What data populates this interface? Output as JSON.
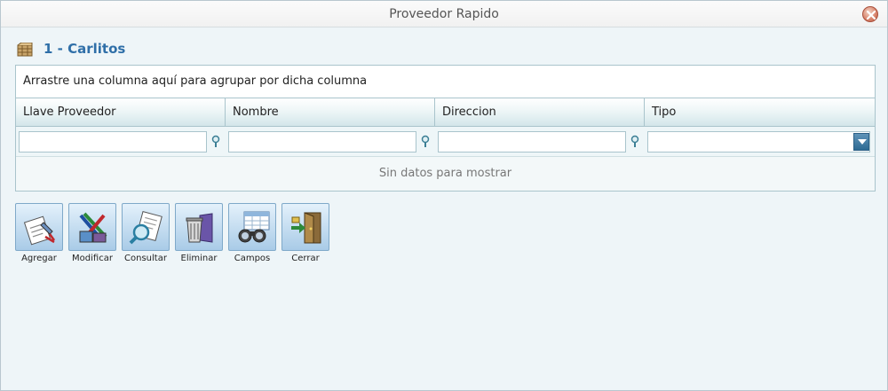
{
  "window": {
    "title": "Proveedor Rapido"
  },
  "heading": {
    "text": "1 - Carlitos"
  },
  "grid": {
    "group_panel_text": "Arrastre una columna aquí para agrupar por dicha columna",
    "columns": [
      "Llave Proveedor",
      "Nombre",
      "Direccion",
      "Tipo"
    ],
    "filters": [
      "",
      "",
      "",
      ""
    ],
    "empty_text": "Sin datos para mostrar"
  },
  "toolbar": {
    "buttons": [
      {
        "label": "Agregar",
        "icon": "add-document-icon"
      },
      {
        "label": "Modificar",
        "icon": "edit-pencils-icon"
      },
      {
        "label": "Consultar",
        "icon": "magnifier-document-icon"
      },
      {
        "label": "Eliminar",
        "icon": "trash-icon"
      },
      {
        "label": "Campos",
        "icon": "binoculars-table-icon"
      },
      {
        "label": "Cerrar",
        "icon": "exit-door-icon"
      }
    ]
  },
  "colors": {
    "heading": "#2f6fa8",
    "border": "#a9c4cc",
    "dropdown": "#2d6a93"
  }
}
